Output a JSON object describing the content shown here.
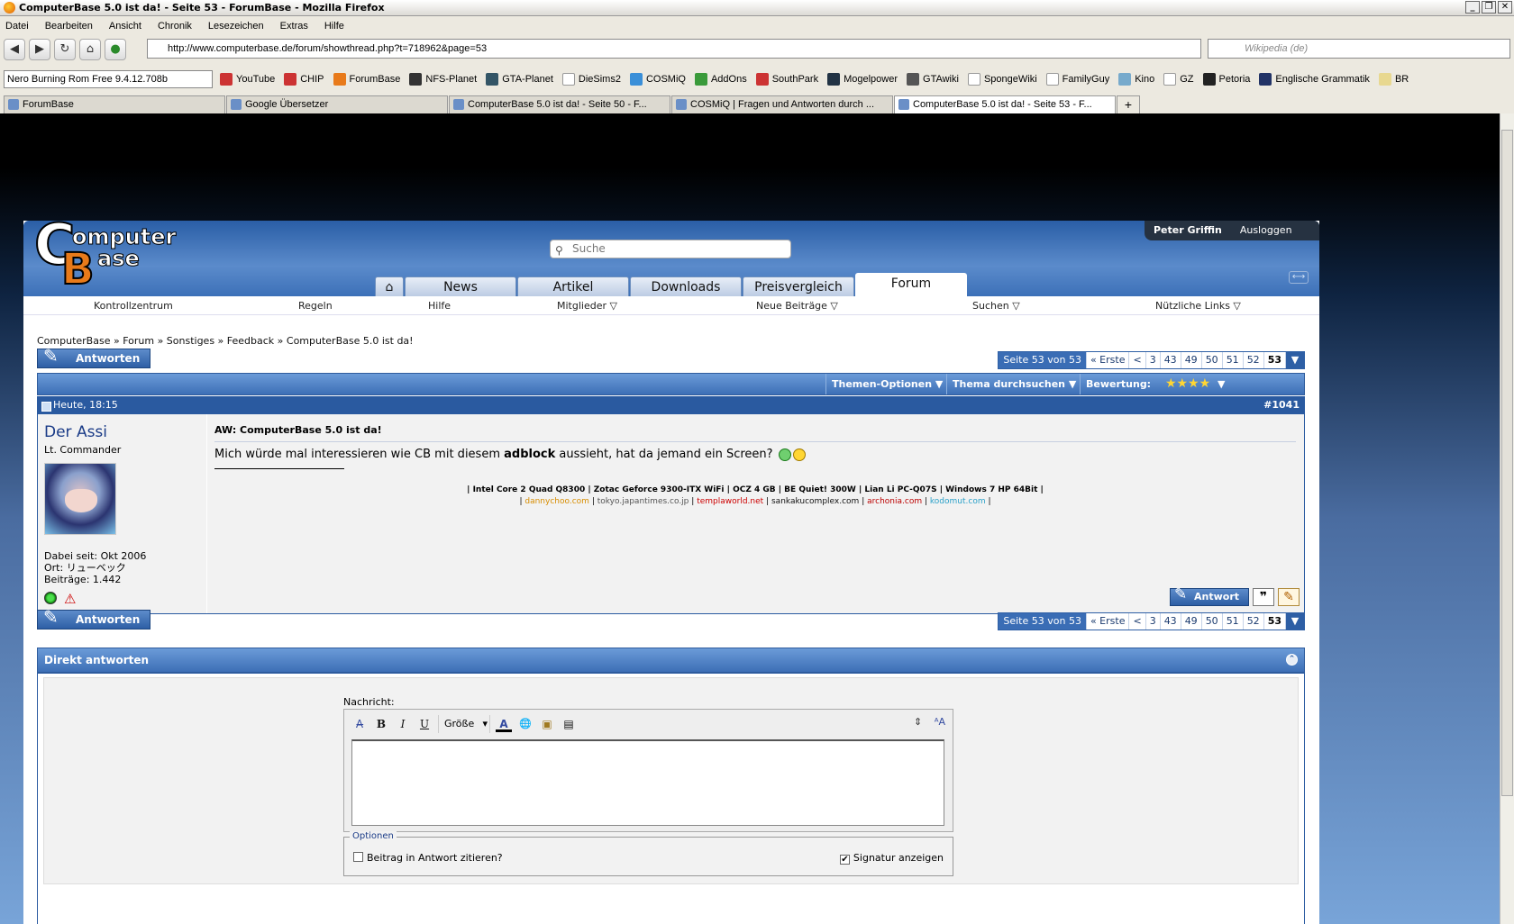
{
  "browser": {
    "title": "ComputerBase 5.0 ist da! - Seite 53 - ForumBase - Mozilla Firefox",
    "menu": [
      "Datei",
      "Bearbeiten",
      "Ansicht",
      "Chronik",
      "Lesezeichen",
      "Extras",
      "Hilfe"
    ],
    "url": "http://www.computerbase.de/forum/showthread.php?t=718962&page=53",
    "search_placeholder": "Wikipedia (de)",
    "nero_select": "Nero Burning Rom Free 9.4.12.708b",
    "bookmarks": [
      "YouTube",
      "CHIP",
      "ForumBase",
      "NFS-Planet",
      "GTA-Planet",
      "DieSims2",
      "COSMiQ",
      "AddOns",
      "SouthPark",
      "Mogelpower",
      "GTAwiki",
      "SpongeWiki",
      "FamilyGuy",
      "Kino",
      "GZ",
      "Petoria",
      "Englische Grammatik",
      "BR"
    ],
    "tabs": [
      "ForumBase",
      "Google Übersetzer",
      "ComputerBase 5.0 ist da! - Seite 50 - F...",
      "COSMiQ | Fragen und Antworten durch ...",
      "ComputerBase 5.0 ist da! - Seite 53 - F..."
    ],
    "window_buttons": [
      "_",
      "❐",
      "✕"
    ]
  },
  "site": {
    "logo": {
      "c": "C",
      "omp": "omputer",
      "b": "B",
      "ase": "ase"
    },
    "search_placeholder": "Suche",
    "user": {
      "name": "Peter Griffin",
      "logout": "Ausloggen"
    },
    "nav": [
      "News",
      "Artikel",
      "Downloads",
      "Preisvergleich",
      "Forum"
    ],
    "subnav": [
      "Kontrollzentrum",
      "Regeln",
      "Hilfe",
      "Mitglieder ▽",
      "Neue Beiträge ▽",
      "Suchen ▽",
      "Nützliche Links ▽"
    ]
  },
  "thread": {
    "breadcrumb": "ComputerBase » Forum » Sonstiges » Feedback » ComputerBase 5.0 ist da!",
    "reply_button": "Antworten",
    "pager": {
      "label": "Seite 53 von 53",
      "first": "« Erste",
      "prev": "<",
      "pages": [
        "3",
        "43",
        "49",
        "50",
        "51",
        "52"
      ],
      "current": "53",
      "dropdown": "▼"
    },
    "toolbar": {
      "options": "Themen-Optionen ▼",
      "search": "Thema durchsuchen ▼",
      "rating_label": "Bewertung:",
      "rating_stars": "★★★★",
      "rating_dd": "▼"
    }
  },
  "post": {
    "date": "Heute, 18:15",
    "number": "#1041",
    "author": "Der Assi",
    "rank": "Lt. Commander",
    "joined": "Dabei seit: Okt 2006",
    "location": "Ort: リューベック",
    "posts": "Beiträge: 1.442",
    "title": "AW: ComputerBase 5.0 ist da!",
    "text_before": "Mich würde mal interessieren wie CB mit diesem ",
    "text_bold": "adblock",
    "text_after": " aussieht, hat da jemand ein Screen? ",
    "sig_line1": "| Intel Core 2 Quad Q8300 | Zotac Geforce 9300-ITX WiFi | OCZ 4 GB | BE Quiet! 300W | Lian Li PC-Q07S | Windows 7 HP 64Bit |",
    "sig_links": [
      "dannychoo.com",
      "tokyo.japantimes.co.jp",
      "templaworld.net",
      "sankakucomplex.com",
      "archonia.com",
      "kodomut.com"
    ],
    "sig_sep": "|",
    "warn_icon": "⚠",
    "reply_btn": "Antwort",
    "quote_btn": "❞",
    "edit_btn": "✎"
  },
  "quickreply": {
    "title": "Direkt antworten",
    "collapse_icon": "⌃",
    "message_label": "Nachricht:",
    "size_select": "Größe",
    "options_legend": "Optionen",
    "opt_quote": "Beitrag in Antwort zitieren?",
    "opt_quote_checked": false,
    "opt_signature": "Signatur anzeigen",
    "opt_signature_checked": true,
    "toolbar_icons": {
      "removeformat": "A̶",
      "bold": "B",
      "italic": "I",
      "underline": "U",
      "color": "A",
      "link": "🌐",
      "image": "▣",
      "quote": "▤",
      "resize": "⇕",
      "switch": "ᴬA"
    }
  },
  "colors": {
    "brand_blue": "#2a5aa0",
    "logo_orange": "#e87a1a"
  }
}
